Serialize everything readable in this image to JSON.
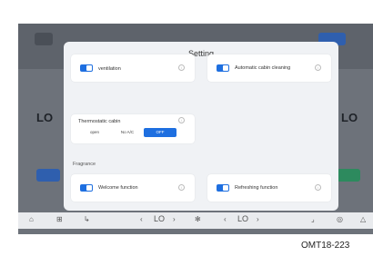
{
  "dialog": {
    "title": "Setting"
  },
  "cards": {
    "ventilation": "ventilation",
    "auto_cleaning": "Automatic cabin cleaning",
    "thermostatic": "Thermostatic cabin",
    "welcome": "Welcome function",
    "refreshing": "Refreshing function"
  },
  "segment": {
    "options": [
      "open",
      "No A/C",
      "OFF"
    ],
    "selected": "OFF"
  },
  "sections": {
    "fragrance": "Fragrance"
  },
  "background": {
    "left_temp": "LO",
    "right_temp": "LO"
  },
  "bottom_bar": {
    "left_temp": "LO",
    "right_temp": "LO"
  },
  "caption": "OMT18-223",
  "colors": {
    "accent": "#1e6fe0",
    "dialog_bg": "#f0f2f5",
    "screen_bg": "#6d727a"
  }
}
